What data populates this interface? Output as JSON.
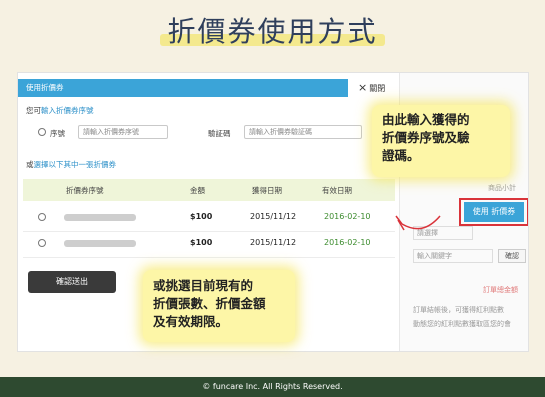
{
  "page": {
    "title": "折價券使用方式",
    "footer": "© funcare Inc. All Rights Reserved."
  },
  "dialog": {
    "header": "使用折價券",
    "close_label": "關閉",
    "close_icon": "×",
    "prompt_prefix": "您可",
    "prompt_link": "輸入折價券序號",
    "serial_label": "序號",
    "serial_placeholder": "請輸入折價券序號",
    "code_label": "驗証碼",
    "code_placeholder": "請輸入折價券驗証碼",
    "choose_prefix": "或",
    "choose_link": "選擇以下其中一張折價券",
    "table": {
      "headers": [
        "折價券序號",
        "金額",
        "獲得日期",
        "有效日期"
      ],
      "rows": [
        {
          "serial": "",
          "amount": "$100",
          "obtained": "2015/11/12",
          "expires": "2016-02-10"
        },
        {
          "serial": "",
          "amount": "$100",
          "obtained": "2015/11/12",
          "expires": "2016-02-10"
        }
      ]
    },
    "confirm_label": "確認送出"
  },
  "background": {
    "use_coupon_label": "使用 折價券",
    "select_placeholder": "請選擇",
    "keyword_placeholder": "輸入關鍵字",
    "confirm_small": "確認"
  },
  "callouts": {
    "top": [
      "由此輸入獲得的",
      "折價券序號及驗",
      "證碼。"
    ],
    "bottom": [
      "或挑選目前現有的",
      "折價張數、折價金額",
      "及有效期限。"
    ]
  },
  "colors": {
    "header_blue": "#3ba4d8",
    "highlight_yellow": "#fdf6a7",
    "footer_green": "#2e4a30",
    "valid_date_green": "#3d8c2f",
    "annotation_red": "#d9333a"
  }
}
